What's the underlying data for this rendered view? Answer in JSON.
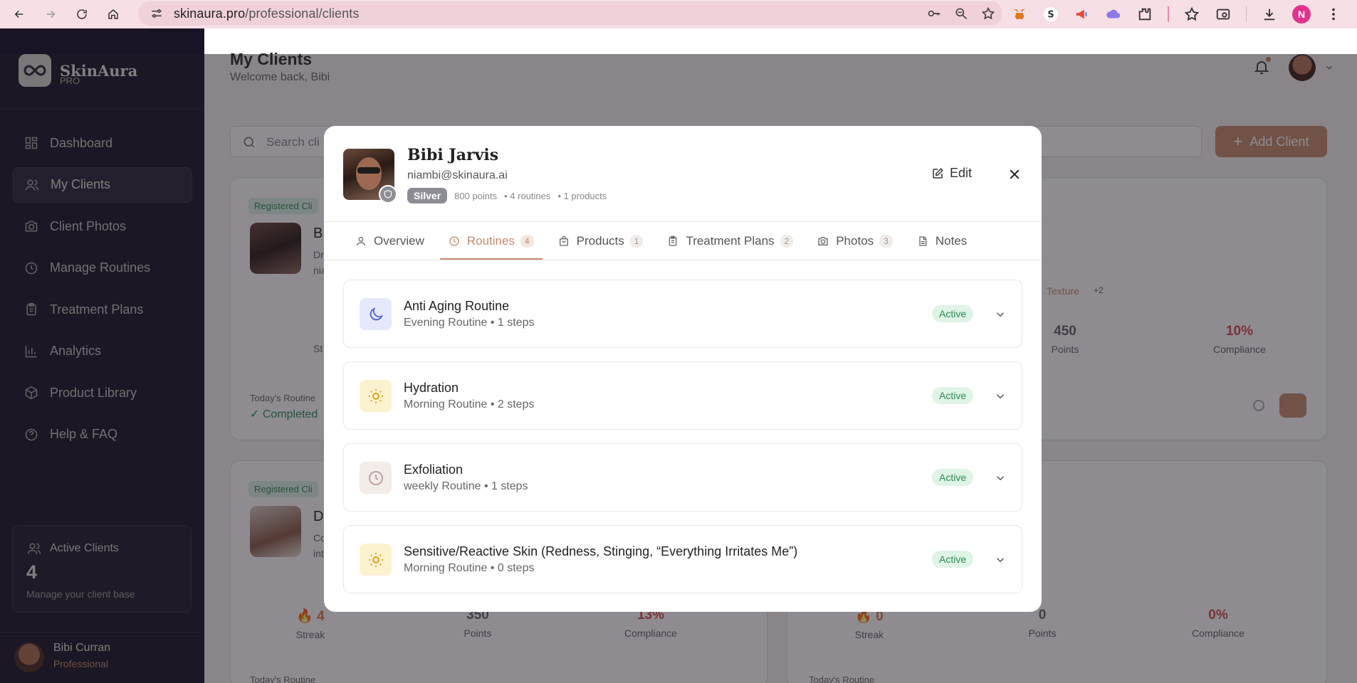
{
  "browser": {
    "url_host": "skinaura.pro",
    "url_path": "/professional/clients"
  },
  "sidebar": {
    "brand": "SkinAura",
    "brand_sub": "PRO",
    "items": [
      {
        "label": "Dashboard",
        "icon": "dashboard-icon"
      },
      {
        "label": "My Clients",
        "icon": "users-icon"
      },
      {
        "label": "Client Photos",
        "icon": "camera-icon"
      },
      {
        "label": "Manage Routines",
        "icon": "clock-icon"
      },
      {
        "label": "Treatment Plans",
        "icon": "clipboard-icon"
      },
      {
        "label": "Analytics",
        "icon": "chart-icon"
      },
      {
        "label": "Product Library",
        "icon": "box-icon"
      },
      {
        "label": "Help & FAQ",
        "icon": "help-icon"
      }
    ],
    "active_card": {
      "label": "Active Clients",
      "value": "4",
      "sub": "Manage your client base"
    },
    "user": {
      "name": "Bibi Curran",
      "role": "Professional"
    }
  },
  "header": {
    "title": "My Clients",
    "subtitle": "Welcome back, Bibi"
  },
  "toolbar": {
    "search_placeholder": "Search cli",
    "add_label": "Add Client"
  },
  "background_cards": {
    "card1": {
      "badge": "Registered Cli",
      "initial": "B",
      "line1": "Dr",
      "line2": "nia",
      "tags": [
        "Texture",
        "+2"
      ],
      "metrics": [
        {
          "value": "450",
          "label": "Points"
        },
        {
          "value": "10%",
          "label": "Compliance"
        }
      ],
      "st": "St",
      "routine_label": "Today's Routine",
      "routine_status": "Completed"
    },
    "card2": {
      "badge": "Registered Cli",
      "initial": "D",
      "line1": "Co",
      "line2": "int",
      "metrics": [
        {
          "value": "4",
          "label": "Streak"
        },
        {
          "value": "350",
          "label": "Points"
        },
        {
          "value": "13%",
          "label": "Compliance"
        }
      ],
      "routine_label": "Today's Routine"
    },
    "card3": {
      "metrics": [
        {
          "value": "0",
          "label": "Streak"
        },
        {
          "value": "0",
          "label": "Points"
        },
        {
          "value": "0%",
          "label": "Compliance"
        }
      ],
      "routine_label": "Today's Routine"
    }
  },
  "modal": {
    "name": "Bibi Jarvis",
    "email": "niambi@skinaura.ai",
    "tier": "Silver",
    "points": "800 points",
    "routines_count": "• 4 routines",
    "products_count": "• 1 products",
    "edit_label": "Edit",
    "tabs": [
      {
        "label": "Overview",
        "count": null,
        "icon": "user-icon"
      },
      {
        "label": "Routines",
        "count": "4",
        "icon": "clock-icon"
      },
      {
        "label": "Products",
        "count": "1",
        "icon": "bag-icon"
      },
      {
        "label": "Treatment Plans",
        "count": "2",
        "icon": "clipboard-icon"
      },
      {
        "label": "Photos",
        "count": "3",
        "icon": "camera-icon"
      },
      {
        "label": "Notes",
        "count": null,
        "icon": "document-icon"
      }
    ],
    "routines": [
      {
        "name": "Anti Aging Routine",
        "sub": "Evening Routine • 1 steps",
        "status": "Active",
        "icon": "moon-icon"
      },
      {
        "name": "Hydration",
        "sub": "Morning Routine • 2 steps",
        "status": "Active",
        "icon": "sun-icon"
      },
      {
        "name": "Exfoliation",
        "sub": "weekly Routine • 1 steps",
        "status": "Active",
        "icon": "clock-icon"
      },
      {
        "name": "Sensitive/Reactive Skin (Redness, Stinging, “Everything Irritates Me”)",
        "sub": "Morning Routine • 0 steps",
        "status": "Active",
        "icon": "sun-icon"
      }
    ]
  }
}
